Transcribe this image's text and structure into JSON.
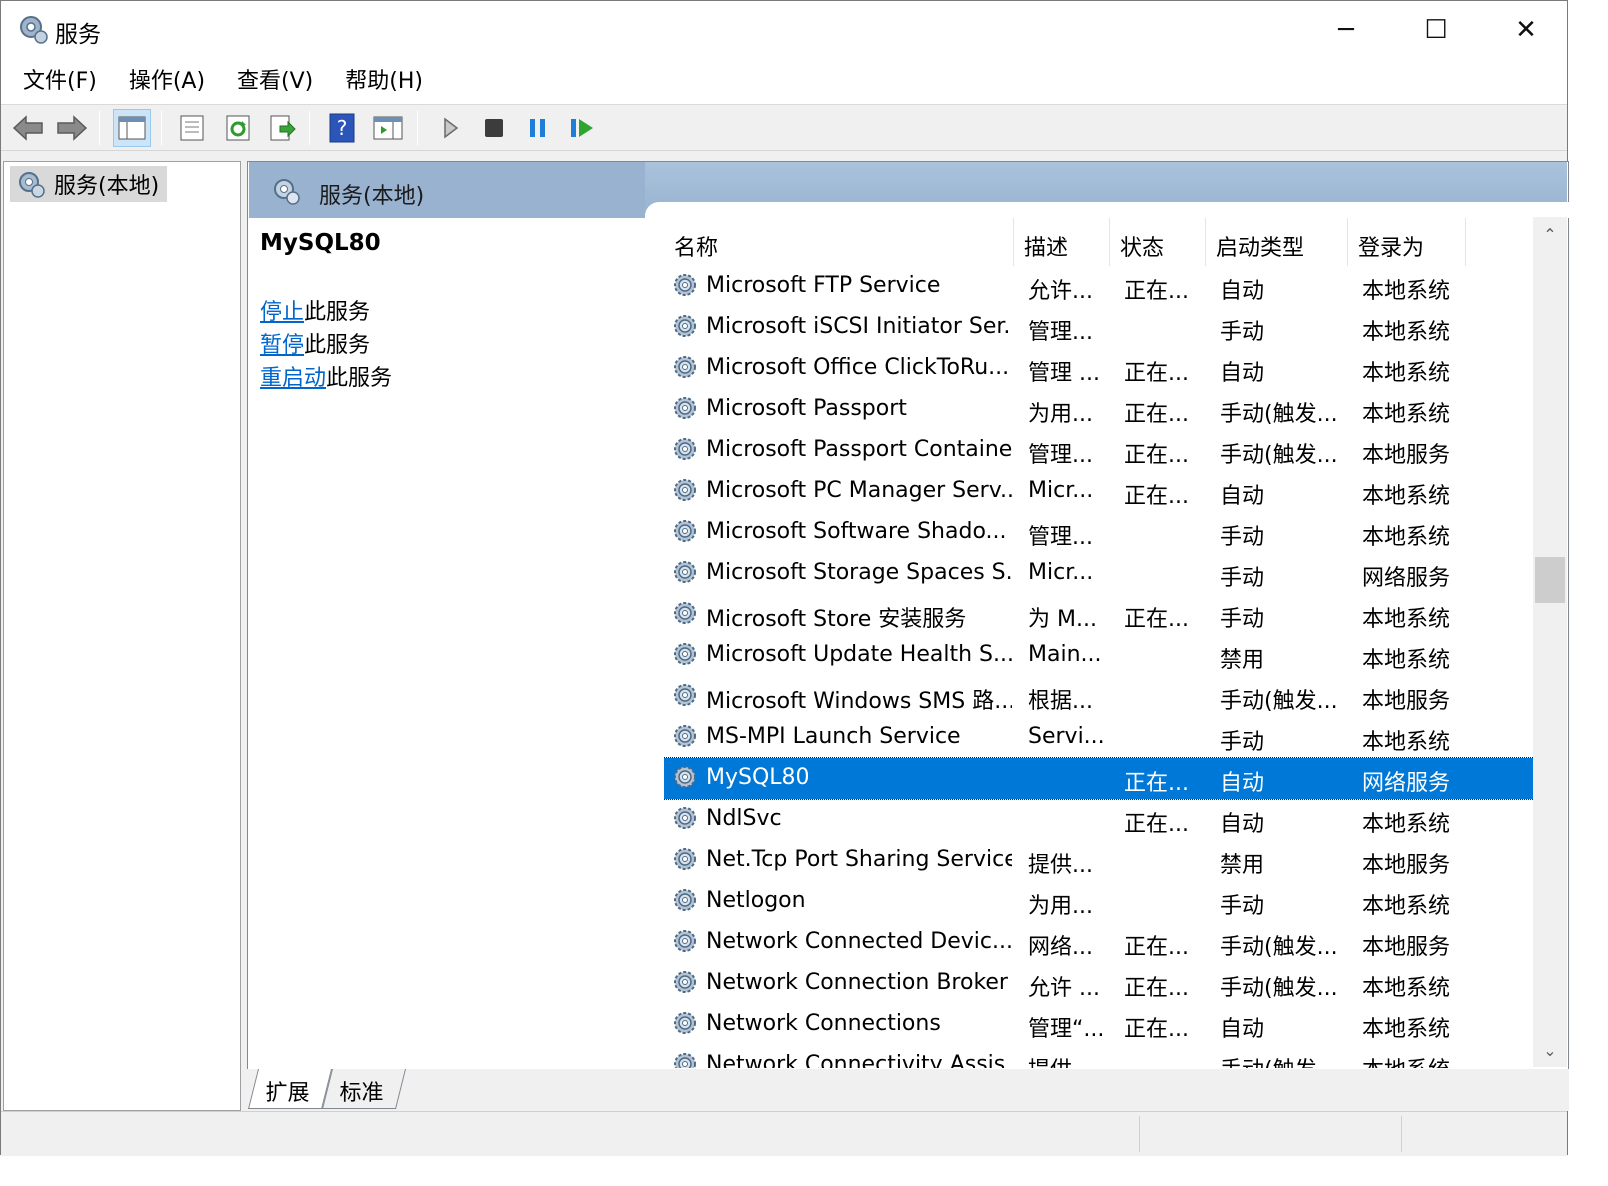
{
  "window": {
    "title": "服务",
    "minimize_symbol": "─",
    "maximize_symbol": "☐",
    "close_symbol": "✕"
  },
  "menu": [
    "文件(F)",
    "操作(A)",
    "查看(V)",
    "帮助(H)"
  ],
  "toolbar": {
    "buttons": [
      "back-icon",
      "forward-icon",
      "show-hide-console-tree-icon",
      "properties-icon",
      "refresh-icon",
      "export-list-icon",
      "help-icon",
      "show-action-pane-icon",
      "start-service-icon",
      "stop-service-icon",
      "pause-service-icon",
      "resume-service-icon"
    ],
    "pressed": "show-hide-console-tree-icon"
  },
  "tree": {
    "root_label": "服务(本地)"
  },
  "pane": {
    "header_title": "服务(本地)"
  },
  "detail": {
    "service_name": "MySQL80",
    "actions": [
      {
        "link": "停止",
        "suffix": "此服务"
      },
      {
        "link": "暂停",
        "suffix": "此服务"
      },
      {
        "link": "重启动",
        "suffix": "此服务"
      }
    ]
  },
  "columns": {
    "name": "名称",
    "sort_arrow": "^",
    "description": "描述",
    "status": "状态",
    "startup_type": "启动类型",
    "logon_as": "登录为"
  },
  "services": [
    {
      "name": "Microsoft FTP Service",
      "description": "允许...",
      "status": "正在...",
      "startup_type": "自动",
      "logon_as": "本地系统"
    },
    {
      "name": "Microsoft iSCSI Initiator Ser...",
      "description": "管理...",
      "status": "",
      "startup_type": "手动",
      "logon_as": "本地系统"
    },
    {
      "name": "Microsoft Office ClickToRu...",
      "description": "管理 ...",
      "status": "正在...",
      "startup_type": "自动",
      "logon_as": "本地系统"
    },
    {
      "name": "Microsoft Passport",
      "description": "为用...",
      "status": "正在...",
      "startup_type": "手动(触发...",
      "logon_as": "本地系统"
    },
    {
      "name": "Microsoft Passport Container",
      "description": "管理...",
      "status": "正在...",
      "startup_type": "手动(触发...",
      "logon_as": "本地服务"
    },
    {
      "name": "Microsoft PC Manager Serv...",
      "description": "Micr...",
      "status": "正在...",
      "startup_type": "自动",
      "logon_as": "本地系统"
    },
    {
      "name": "Microsoft Software Shado...",
      "description": "管理...",
      "status": "",
      "startup_type": "手动",
      "logon_as": "本地系统"
    },
    {
      "name": "Microsoft Storage Spaces S...",
      "description": "Micr...",
      "status": "",
      "startup_type": "手动",
      "logon_as": "网络服务"
    },
    {
      "name": "Microsoft Store 安装服务",
      "description": "为 M...",
      "status": "正在...",
      "startup_type": "手动",
      "logon_as": "本地系统"
    },
    {
      "name": "Microsoft Update Health S...",
      "description": "Main...",
      "status": "",
      "startup_type": "禁用",
      "logon_as": "本地系统"
    },
    {
      "name": "Microsoft Windows SMS 路...",
      "description": "根据...",
      "status": "",
      "startup_type": "手动(触发...",
      "logon_as": "本地服务"
    },
    {
      "name": "MS-MPI Launch Service",
      "description": "Servi...",
      "status": "",
      "startup_type": "手动",
      "logon_as": "本地系统"
    },
    {
      "name": "MySQL80",
      "description": "",
      "status": "正在...",
      "startup_type": "自动",
      "logon_as": "网络服务",
      "selected": true
    },
    {
      "name": "NdlSvc",
      "description": "",
      "status": "正在...",
      "startup_type": "自动",
      "logon_as": "本地系统"
    },
    {
      "name": "Net.Tcp Port Sharing Service",
      "description": "提供...",
      "status": "",
      "startup_type": "禁用",
      "logon_as": "本地服务"
    },
    {
      "name": "Netlogon",
      "description": "为用...",
      "status": "",
      "startup_type": "手动",
      "logon_as": "本地系统"
    },
    {
      "name": "Network Connected Devic...",
      "description": "网络...",
      "status": "正在...",
      "startup_type": "手动(触发...",
      "logon_as": "本地服务"
    },
    {
      "name": "Network Connection Broker",
      "description": "允许 ...",
      "status": "正在...",
      "startup_type": "手动(触发...",
      "logon_as": "本地系统"
    },
    {
      "name": "Network Connections",
      "description": "管理“...",
      "status": "正在...",
      "startup_type": "自动",
      "logon_as": "本地系统"
    },
    {
      "name": "Network Connectivity Assis...",
      "description": "提供...",
      "status": "",
      "startup_type": "手动(触发...",
      "logon_as": "本地系统"
    }
  ],
  "scrollbar": {
    "up_symbol": "⌃",
    "down_symbol": "⌄"
  },
  "tabs": [
    "扩展",
    "标准"
  ],
  "colors": {
    "selection": "#0078d7",
    "link": "#0066cc",
    "header_blue": "#98b2d0"
  }
}
